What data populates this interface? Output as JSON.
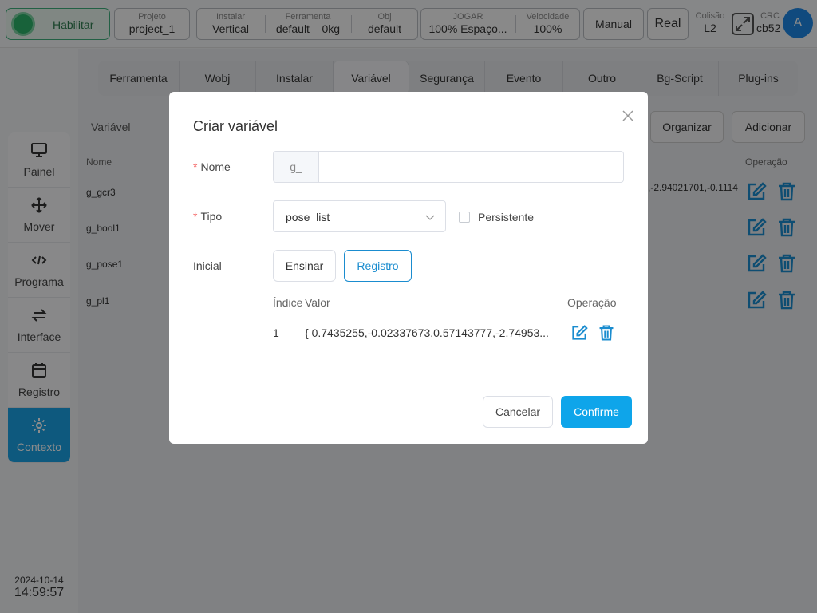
{
  "topbar": {
    "enable_label": "Habilitar",
    "project": {
      "title": "Projeto",
      "value": "project_1"
    },
    "install": {
      "title": "Instalar",
      "value": "Vertical"
    },
    "tool": {
      "title": "Ferramenta",
      "value_name": "default",
      "value_load": "0kg"
    },
    "obj": {
      "title": "Obj",
      "value": "default"
    },
    "jog": {
      "title": "JOGAR",
      "value": "100%  Espaço..."
    },
    "speed": {
      "title": "Velocidade",
      "value": "100%"
    },
    "mode": "Manual",
    "real": "Real",
    "collision": {
      "title": "Colisão",
      "value": "L2"
    },
    "crc": {
      "title": "CRC",
      "value": "cb52"
    },
    "avatar": "A"
  },
  "nav": {
    "items": [
      {
        "label": "Painel",
        "icon": "monitor-icon"
      },
      {
        "label": "Mover",
        "icon": "move-icon"
      },
      {
        "label": "Programa",
        "icon": "code-icon"
      },
      {
        "label": "Interface",
        "icon": "swap-icon"
      },
      {
        "label": "Registro",
        "icon": "calendar-icon"
      },
      {
        "label": "Contexto",
        "icon": "gear-icon"
      }
    ],
    "active": "Contexto"
  },
  "datetime": {
    "date": "2024-10-14",
    "time": "14:59:57"
  },
  "tabs": [
    "Ferramenta",
    "Wobj",
    "Instalar",
    "Variável",
    "Segurança",
    "Evento",
    "Outro",
    "Bg-Script",
    "Plug-ins"
  ],
  "active_tab": "Variável",
  "toolbar": {
    "label": "Variável",
    "organize": "Organizar",
    "add": "Adicionar"
  },
  "variables_table": {
    "col_name": "Nome",
    "col_operation": "Operação",
    "rows": [
      {
        "name": "g_gcr3",
        "value_fragment": ",-2.94021701,-0.1114"
      },
      {
        "name": "g_bool1"
      },
      {
        "name": "g_pose1"
      },
      {
        "name": "g_pl1"
      }
    ]
  },
  "modal": {
    "title": "Criar variável",
    "name_label": "Nome",
    "name_prefix": "g_",
    "name_value": "",
    "type_label": "Tipo",
    "type_value": "pose_list",
    "persistent_label": "Persistente",
    "initial_label": "Inicial",
    "teach_button": "Ensinar",
    "record_button": "Registro",
    "table": {
      "col_index": "Índice",
      "col_value": "Valor",
      "col_operation": "Operação",
      "rows": [
        {
          "index": "1",
          "value": "{ 0.7435255,-0.02337673,0.57143777,-2.74953..."
        }
      ]
    },
    "cancel": "Cancelar",
    "confirm": "Confirme"
  },
  "colors": {
    "accent": "#0ea5ea",
    "edit": "#1a8ccf",
    "enable": "#2db36a"
  }
}
